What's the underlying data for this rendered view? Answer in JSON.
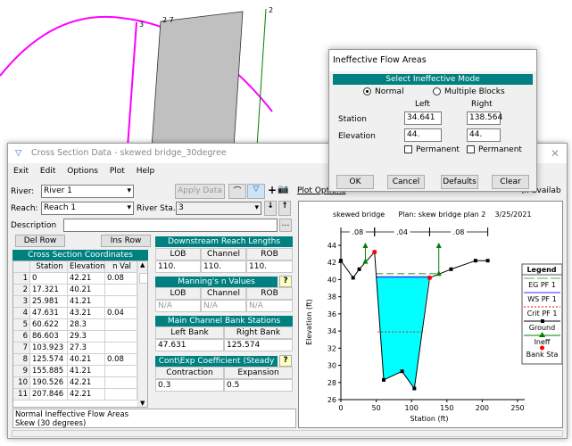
{
  "schematic": {
    "labels": [
      "3",
      "2 7",
      "2"
    ],
    "colors": {
      "cross_section": "#ff00ff",
      "bridge": "#c0c0c0",
      "downstream": "#008000"
    }
  },
  "window": {
    "title": "Cross Section Data - skewed bridge_30degree",
    "menu": [
      "Exit",
      "Edit",
      "Options",
      "Plot",
      "Help"
    ],
    "river_label": "River:",
    "river": "River 1",
    "reach_label": "Reach:",
    "reach": "Reach 1",
    "river_sta_label": "River Sta.:",
    "river_sta": "3",
    "apply_data": "Apply Data",
    "description_label": "Description",
    "description": "",
    "plot_options": "Plot Options",
    "plot_options_trail": "(if availab",
    "del_row": "Del Row",
    "ins_row": "Ins Row",
    "coords": {
      "title": "Cross Section Coordinates",
      "headers": [
        "Station",
        "Elevation",
        "n Val"
      ],
      "rows": [
        [
          "1",
          "0",
          "42.21",
          "0.08"
        ],
        [
          "2",
          "17.321",
          "40.21",
          ""
        ],
        [
          "3",
          "25.981",
          "41.21",
          ""
        ],
        [
          "4",
          "47.631",
          "43.21",
          "0.04"
        ],
        [
          "5",
          "60.622",
          "28.3",
          ""
        ],
        [
          "6",
          "86.603",
          "29.3",
          ""
        ],
        [
          "7",
          "103.923",
          "27.3",
          ""
        ],
        [
          "8",
          "125.574",
          "40.21",
          "0.08"
        ],
        [
          "9",
          "155.885",
          "41.21",
          ""
        ],
        [
          "10",
          "190.526",
          "42.21",
          ""
        ],
        [
          "11",
          "207.846",
          "42.21",
          ""
        ]
      ]
    },
    "reach_lengths": {
      "title": "Downstream Reach Lengths",
      "labels": [
        "LOB",
        "Channel",
        "ROB"
      ],
      "values": [
        "110.",
        "110.",
        "110."
      ]
    },
    "mannings": {
      "title": "Manning's n Values",
      "labels": [
        "LOB",
        "Channel",
        "ROB"
      ],
      "values": [
        "N/A",
        "N/A",
        "N/A"
      ]
    },
    "bank_stations": {
      "title": "Main Channel Bank Stations",
      "labels": [
        "Left Bank",
        "Right Bank"
      ],
      "values": [
        "47.631",
        "125.574"
      ]
    },
    "coefficients": {
      "title": "Cont\\Exp Coefficient (Steady",
      "labels": [
        "Contraction",
        "Expansion"
      ],
      "values": [
        "0.3",
        "0.5"
      ]
    },
    "status_lines": [
      "Normal Ineffective Flow Areas",
      "Skew (30 degrees)"
    ]
  },
  "dialog": {
    "title": "Ineffective Flow Areas",
    "mode_header": "Select Ineffective Mode",
    "mode_options": [
      "Normal",
      "Multiple Blocks"
    ],
    "selected_mode": "Normal",
    "col_left": "Left",
    "col_right": "Right",
    "station_label": "Station",
    "elevation_label": "Elevation",
    "station_left": "34.641",
    "station_right": "138.564",
    "elevation_left": "44.",
    "elevation_right": "44.",
    "permanent_label": "Permanent",
    "permanent_left": false,
    "permanent_right": false,
    "buttons": [
      "OK",
      "Cancel",
      "Defaults",
      "Clear"
    ]
  },
  "chart_data": {
    "type": "line",
    "title": "skewed bridge      Plan: skew bridge plan 2    3/25/2021",
    "xlabel": "Station (ft)",
    "ylabel": "Elevation (ft)",
    "xlim": [
      0,
      250
    ],
    "ylim": [
      26,
      44
    ],
    "xticks": [
      0,
      50,
      100,
      150,
      200,
      250
    ],
    "yticks": [
      26,
      28,
      30,
      32,
      34,
      36,
      38,
      40,
      42,
      44
    ],
    "n_segments": [
      {
        "label": ".08",
        "from": 0,
        "to": 47.631
      },
      {
        "label": ".04",
        "from": 47.631,
        "to": 125.574
      },
      {
        "label": ".08",
        "from": 125.574,
        "to": 207.846
      }
    ],
    "ground": {
      "x": [
        0,
        17.321,
        25.981,
        47.631,
        60.622,
        86.603,
        103.923,
        125.574,
        155.885,
        190.526,
        207.846
      ],
      "y": [
        42.21,
        40.21,
        41.21,
        43.21,
        28.3,
        29.3,
        27.3,
        40.21,
        41.21,
        42.21,
        42.21
      ]
    },
    "ws_pf1": 40.3,
    "eg_pf1": 40.7,
    "crit_pf1": {
      "elev": 33.9,
      "x": [
        52,
        118
      ]
    },
    "ineff": [
      {
        "station": 34.641,
        "ground": 42.06,
        "elev": 44
      },
      {
        "station": 138.564,
        "ground": 40.64,
        "elev": 44
      }
    ],
    "bank_sta": [
      {
        "x": 47.631,
        "y": 43.21
      },
      {
        "x": 125.574,
        "y": 40.21
      }
    ],
    "legend": {
      "title": "Legend",
      "placement": "right",
      "entries": [
        {
          "name": "EG PF 1",
          "color": "#4caf50"
        },
        {
          "name": "WS PF 1",
          "color": "#3333ff"
        },
        {
          "name": "Crit PF 1",
          "color": "#ff0000"
        },
        {
          "name": "Ground",
          "color": "#000000"
        },
        {
          "name": "Ineff",
          "color": "#008000"
        },
        {
          "name": "Bank Sta",
          "color": "#ff0000"
        }
      ]
    },
    "water_color": "#00ffff"
  }
}
